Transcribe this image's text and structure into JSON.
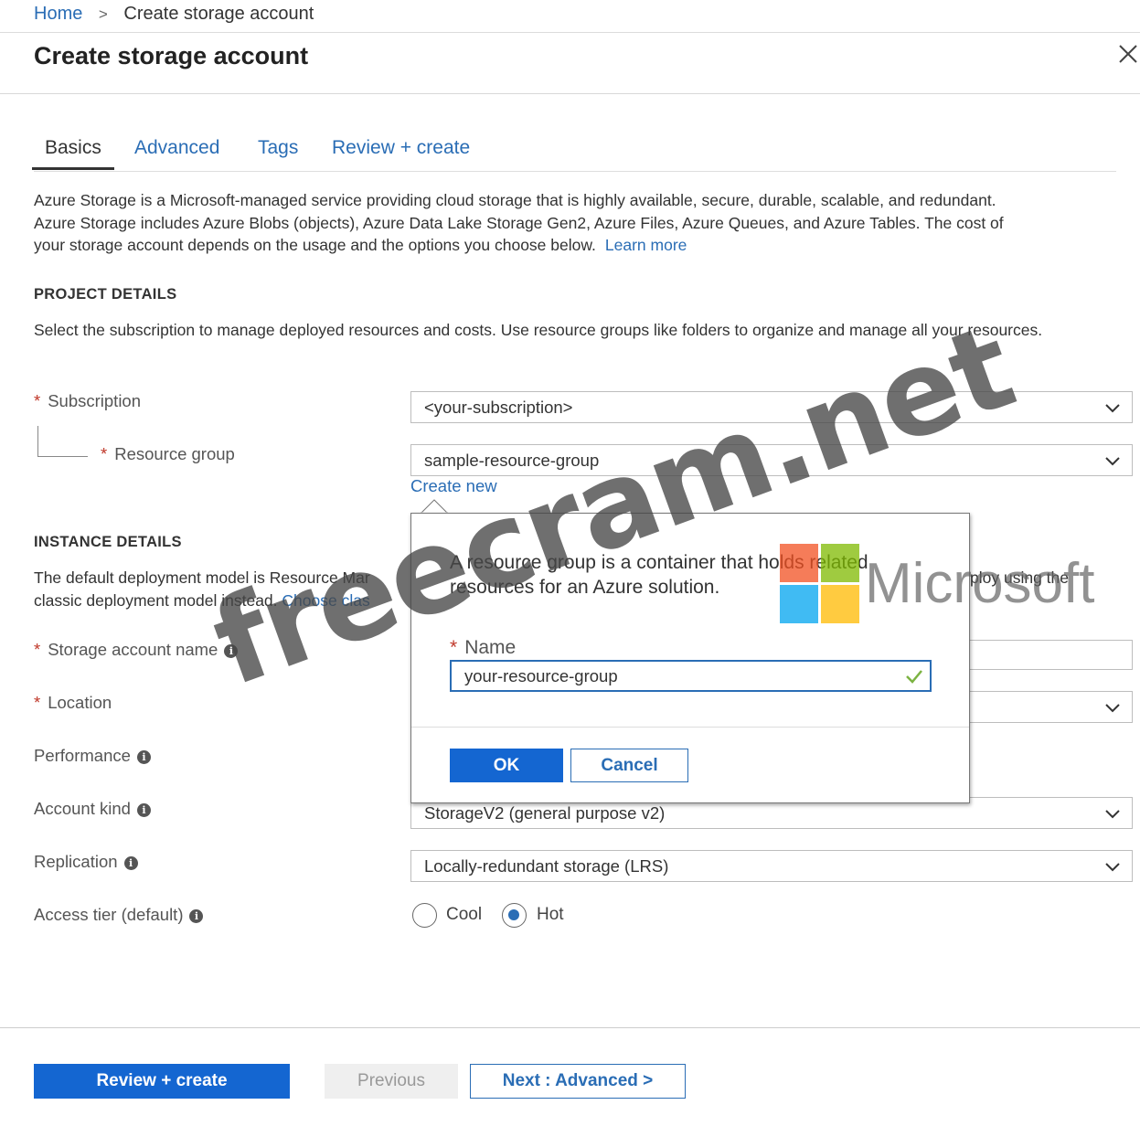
{
  "breadcrumb": {
    "home": "Home",
    "separator": ">",
    "current": "Create storage account"
  },
  "page": {
    "title": "Create storage account",
    "close_icon": "close-icon"
  },
  "tabs": [
    {
      "label": "Basics",
      "active": true
    },
    {
      "label": "Advanced",
      "active": false
    },
    {
      "label": "Tags",
      "active": false
    },
    {
      "label": "Review + create",
      "active": false
    }
  ],
  "intro": {
    "line1": "Azure Storage is a Microsoft-managed service providing cloud storage that is highly available, secure, durable, scalable, and redundant.",
    "line2": "Azure Storage includes Azure Blobs (objects), Azure Data Lake Storage Gen2, Azure Files, Azure Queues, and Azure Tables. The cost of",
    "line3": "your storage account depends on the usage and the options you choose below.",
    "learn_more": "Learn more"
  },
  "project_details": {
    "heading": "PROJECT DETAILS",
    "description": "Select the subscription to manage deployed resources and costs. Use resource groups like folders to organize and manage all your resources.",
    "subscription_label": "Subscription",
    "subscription_value": "<your-subscription>",
    "resource_group_label": "Resource group",
    "resource_group_value": "sample-resource-group",
    "create_new": "Create new"
  },
  "instance_details": {
    "heading": "INSTANCE DETAILS",
    "desc_line1_start": "The default deployment model is Resource Mar",
    "desc_line1_end": "ploy using the",
    "desc_line2": "classic deployment model instead.",
    "choose_link": "Choose clas",
    "storage_account_name_label": "Storage account name",
    "location_label": "Location",
    "performance_label": "Performance",
    "account_kind_label": "Account kind",
    "account_kind_value": "StorageV2 (general purpose v2)",
    "replication_label": "Replication",
    "replication_value": "Locally-redundant storage (LRS)",
    "access_tier_label": "Access tier (default)",
    "access_tier_options": [
      {
        "label": "Cool",
        "checked": false
      },
      {
        "label": "Hot",
        "checked": true
      }
    ]
  },
  "callout": {
    "text": "A resource group is a container that holds related resources for an Azure solution.",
    "name_label": "Name",
    "name_value": "your-resource-group",
    "ok_label": "OK",
    "cancel_label": "Cancel"
  },
  "footer": {
    "review_create": "Review + create",
    "previous": "Previous",
    "next": "Next : Advanced >"
  },
  "watermark": {
    "text": "freecram.net",
    "brand": "Microsoft"
  },
  "colors": {
    "accent": "#1466d1",
    "link": "#2a6db5",
    "required": "#c0392b",
    "valid_check": "#7cb342"
  }
}
